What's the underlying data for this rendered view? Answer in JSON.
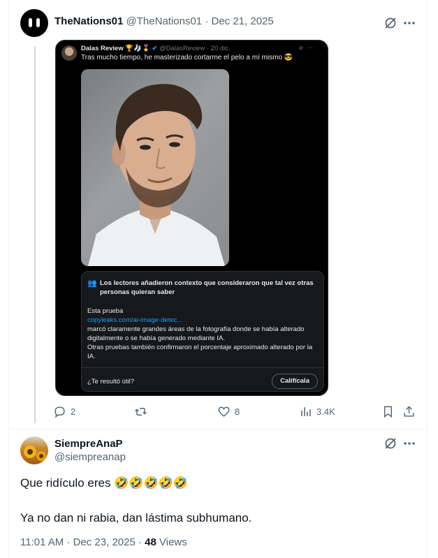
{
  "tweet": {
    "author_name": "TheNations01",
    "author_handle": "@TheNations01",
    "date": "Dec 21, 2025",
    "separator": "·",
    "embedded": {
      "name": "Dalas Review",
      "badges": "🏆🧦🎖️",
      "handle": "@DalasReview",
      "date": "20 dic.",
      "more": "···",
      "text": "Tras mucho tiempo, he masterizado cortarme el pelo a mí mismo 😎",
      "community_note": {
        "title": "Los lectores añadieron contexto que consideraron que tal vez otras personas quieran saber",
        "line1": "Esta prueba",
        "link": "copyleaks.com/ai-image-detec...",
        "line2": "marcó claramente grandes áreas de la fotografía donde se había alterado digitalmente o se había generado mediante IA.",
        "line3": "Otras pruebas también confirmaron el porcentaje aproximado alterado por la IA.",
        "question": "¿Te resultó útil?",
        "rate_button": "Califícala"
      }
    },
    "actions": {
      "replies": "2",
      "retweets": "",
      "likes": "8",
      "views": "3.4K"
    }
  },
  "reply": {
    "author_name": "SiempreAnaP",
    "author_handle": "@siempreanap",
    "line1": "Que ridículo eres 🤣🤣🤣🤣🤣",
    "line2": "Ya no dan ni rabia, dan lástima subhumano.",
    "time": "11:01 AM · Dec 23, 2025 · ",
    "views_count": "48",
    "views_label": " Views"
  },
  "colors": {
    "text": "#0f1419",
    "muted": "#536471",
    "link": "#1d9bf0",
    "border": "#eff3f4"
  },
  "icons": [
    "grok-icon",
    "more-icon",
    "reply-icon",
    "retweet-icon",
    "like-icon",
    "views-icon",
    "bookmark-icon",
    "share-icon",
    "community-note-icon"
  ]
}
